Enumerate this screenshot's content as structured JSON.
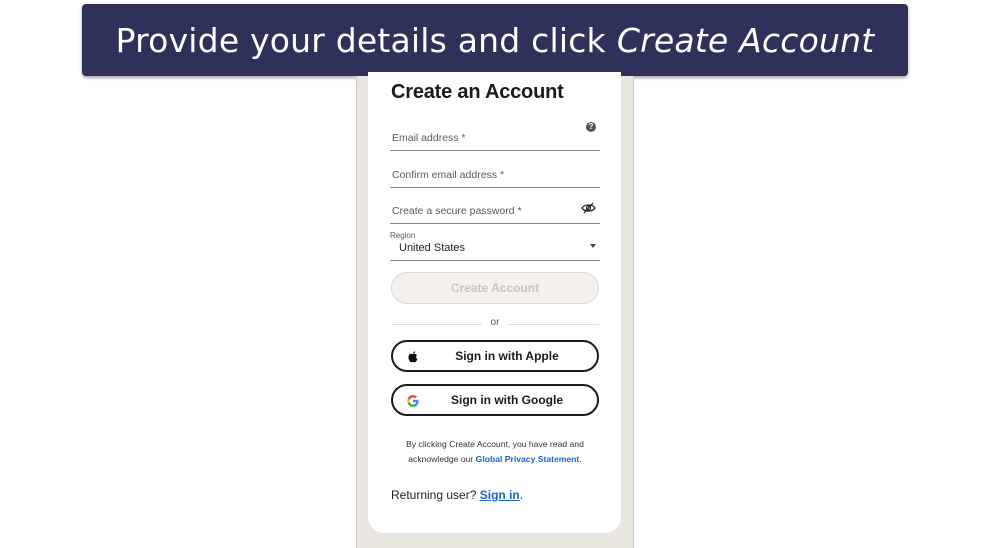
{
  "banner": {
    "text": "Provide your details and click",
    "emphasis": "Create Account"
  },
  "form": {
    "title": "Create an Account",
    "email_placeholder": "Email address *",
    "confirm_email_placeholder": "Confirm email address *",
    "password_placeholder": "Create a secure password *",
    "region_label": "Region",
    "region_value": "United States",
    "create_button": "Create Account",
    "divider_text": "or",
    "apple_button": "Sign in with Apple",
    "google_button": "Sign in with Google",
    "legal_text": "By clicking Create Account, you have read and acknowledge our",
    "legal_link": "Global Privacy Statement",
    "legal_end": ".",
    "returning_text": "Returning user?",
    "signin_link": "Sign in",
    "signin_end": "."
  },
  "icons": {
    "help": "help-circle-icon",
    "password": "eye-off-icon",
    "region": "caret-down-icon",
    "apple": "apple-icon",
    "google": "google-icon"
  },
  "colors": {
    "banner_bg": "#2e3159",
    "link": "#1b62c7",
    "disabled_button_bg": "#f4f1ec"
  }
}
